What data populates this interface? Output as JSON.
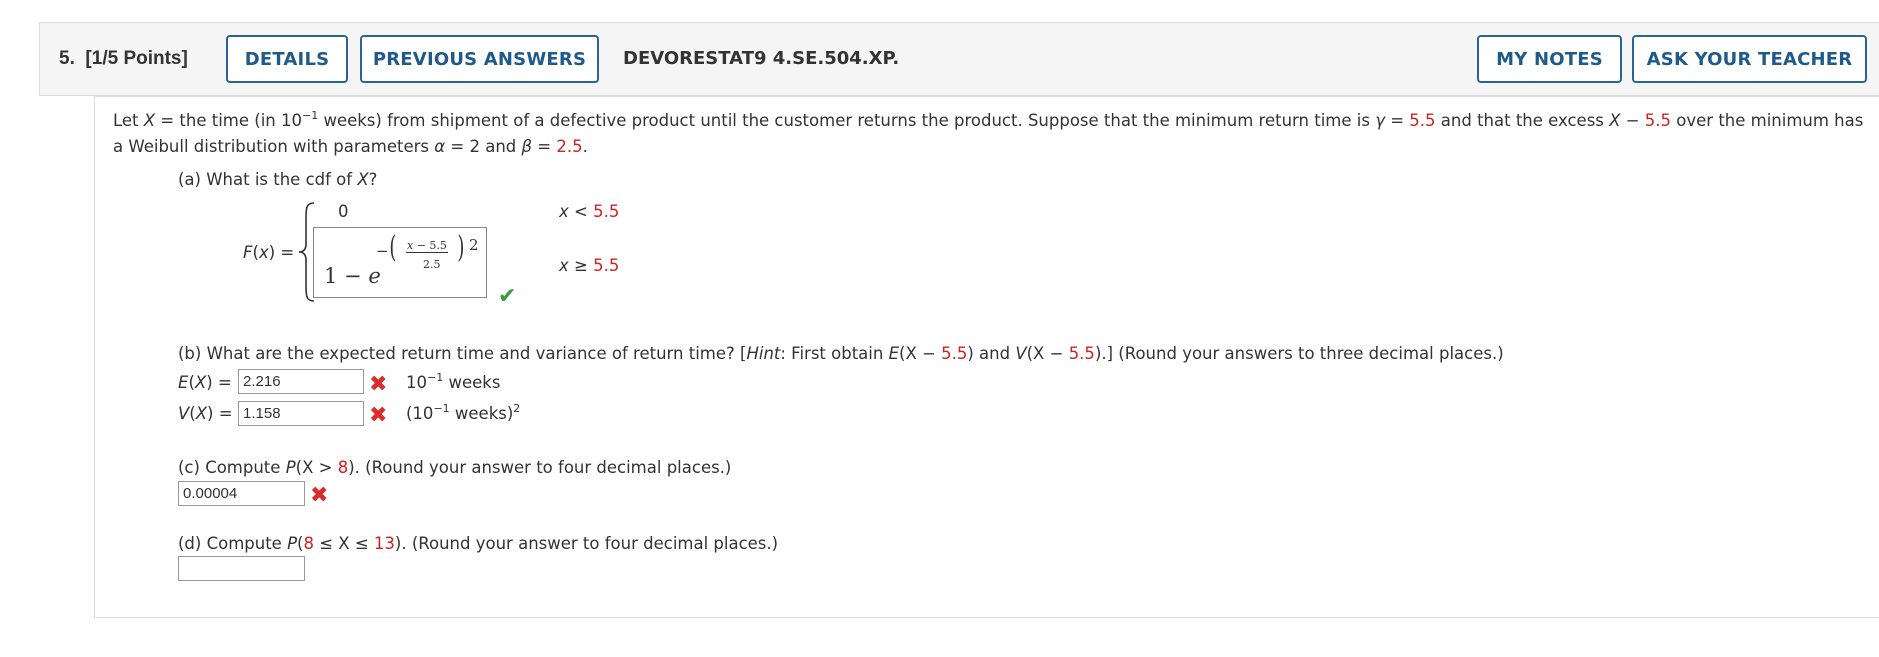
{
  "header": {
    "question_number": "5.",
    "points": "[1/5 Points]",
    "details_label": "DETAILS",
    "previous_answers_label": "PREVIOUS ANSWERS",
    "question_id": "DEVORESTAT9 4.SE.504.XP.",
    "my_notes_label": "MY NOTES",
    "ask_teacher_label": "ASK YOUR TEACHER"
  },
  "problem": {
    "intro_1a": "Let ",
    "intro_1b": " = the time (in 10",
    "intro_1c": " weeks) from shipment of a defective product until the customer returns the product. Suppose that the minimum return time is ",
    "gamma": "γ",
    "eq": " = ",
    "min_return": "5.5",
    "intro_1d": " and that the excess ",
    "intro_1e": " over the minimum has",
    "intro_2a": "a Weibull distribution with parameters ",
    "alpha": "α",
    "alpha_val": " = 2 and ",
    "beta": "β",
    "beta_val": "2.5",
    "intro_2b": ".",
    "var_x": "X",
    "exp_neg1": "−1",
    "minus": " − "
  },
  "part_a": {
    "question": "(a) What is the cdf of ",
    "question_end": "?",
    "fx_label": "F(x) =",
    "piece1_value": "0",
    "piece1_cond_pre": "x < ",
    "piece1_cond_val": "5.5",
    "piece2_formula_one": "1 − e",
    "piece2_neg": "−",
    "piece2_num": "x − 5.5",
    "piece2_den": "2.5",
    "piece2_pow": "2",
    "piece2_cond_pre": "x ≥ ",
    "piece2_cond_val": "5.5",
    "status": "correct"
  },
  "part_b": {
    "question_a": "(b) What are the expected return time and variance of return time? [",
    "hint": "Hint",
    "question_b": ": First obtain ",
    "ex": "E",
    "vx": "V",
    "x_minus": "(X − ",
    "val": "5.5",
    "close": ")",
    "and": " and ",
    "question_c": ".] (Round your answers to three decimal places.)",
    "ex_label": "E(X) =",
    "ex_value": "2.216",
    "ex_unit_pre": "10",
    "ex_unit_exp": "−1",
    "ex_unit_post": " weeks",
    "vx_label": "V(X) =",
    "vx_value": "1.158",
    "vx_unit_pre": "(10",
    "vx_unit_exp": "−1",
    "vx_unit_post": " weeks)",
    "vx_unit_pow": "2",
    "status": "incorrect"
  },
  "part_c": {
    "question_a": "(c) Compute ",
    "p": "P",
    "question_b": "(X > ",
    "val": "8",
    "question_c": "). (Round your answer to four decimal places.)",
    "answer": "0.00004",
    "status": "incorrect"
  },
  "part_d": {
    "question_a": "(d) Compute ",
    "p": "P",
    "paren": "(",
    "low": "8",
    "mid": " ≤ X ≤ ",
    "high": "13",
    "question_c": "). (Round your answer to four decimal places.)",
    "answer": ""
  },
  "colors": {
    "accent": "#2a6496",
    "value_red": "#cc2222",
    "correct": "#3a9a3a",
    "incorrect": "#dd2a2a"
  }
}
